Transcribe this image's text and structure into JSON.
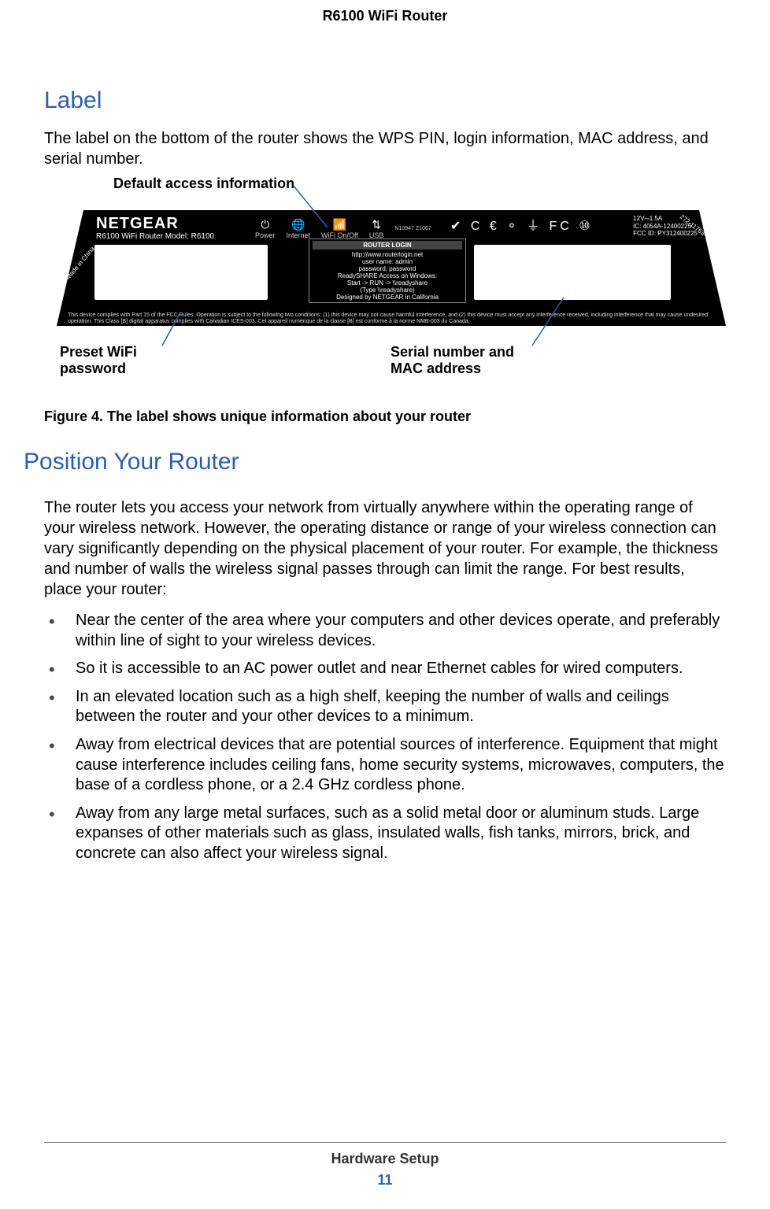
{
  "header": {
    "title": "R6100 WiFi Router"
  },
  "section_label": {
    "heading": "Label",
    "paragraph": "The label on the bottom of the router shows the WPS PIN, login information, MAC address, and serial number.",
    "callouts": {
      "default_access": "Default access information",
      "preset_wifi_l1": "Preset WiFi",
      "preset_wifi_l2": "password",
      "serial_mac_l1": "Serial number and",
      "serial_mac_l2": "MAC address"
    },
    "label_graphic": {
      "brand": "NETGEAR",
      "model": "R6100 WiFi Router Model: R6100",
      "icons": {
        "power": "Power",
        "internet": "Internet",
        "wifi": "WiFi On/Off",
        "usb": "USB"
      },
      "nref": "N10947 Z1067",
      "router_login_hdr": "ROUTER LOGIN",
      "router_login_body": "http://www.routerlogin.net\nuser name:  admin\npassword:  password\nReadySHARE Access on Windows:\nStart -> RUN -> \\\\readyshare\n(Type \\\\readyshare)\nDesigned by NETGEAR in California",
      "certs": "✔ C € ⚬ ⏚ FC ⑩",
      "right_small": "12V⎓1.5A\nIC: 4054A-12400225\nFCC ID: PY312400225",
      "side_num": "272-11763-01",
      "side_made": "Made in China",
      "fine_print": "This device complies with Part 15 of the FCC Rules. Operation is subject to the following two conditions: (1) this device may not cause harmful interference, and (2) this device must accept any interference received, including interference that may cause undesired operation.      This Class [B] digital apparatus complies with Canadian ICES-003. Cet appareil numérique de la classe [B] est conforme à la norme NMB-003 du Canada."
    },
    "figure_caption": "Figure 4. The label shows unique information about your router"
  },
  "section_position": {
    "heading": "Position Your Router",
    "paragraph": "The router lets you access your network from virtually anywhere within the operating range of your wireless network. However, the operating distance or range of your wireless connection can vary significantly depending on the physical placement of your router. For example, the thickness and number of walls the wireless signal passes through can limit the range. For best results, place your router:",
    "bullets": [
      "Near the center of the area where your computers and other devices operate, and preferably within line of sight to your wireless devices.",
      "So it is accessible to an AC power outlet and near Ethernet cables for wired computers.",
      "In an elevated location such as a high shelf, keeping the number of walls and ceilings between the router and your other devices to a minimum.",
      "Away from electrical devices that are potential sources of interference. Equipment that might cause interference includes ceiling fans, home security systems, microwaves, computers, the base of a cordless phone, or a 2.4 GHz cordless phone.",
      "Away from any large metal surfaces, such as a solid metal door or aluminum studs. Large expanses of other materials such as glass, insulated walls, fish tanks, mirrors, brick, and concrete can also affect your wireless signal."
    ]
  },
  "footer": {
    "chapter": "Hardware Setup",
    "page": "11"
  }
}
